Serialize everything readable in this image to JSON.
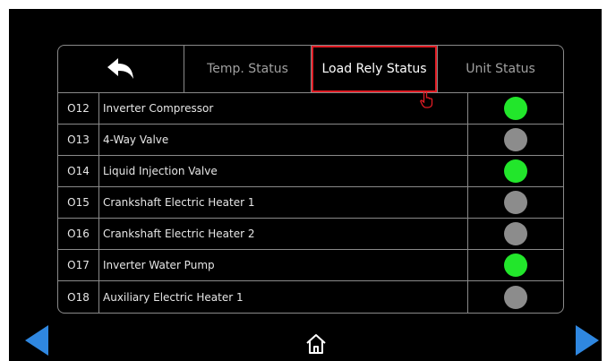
{
  "tabs": {
    "back_icon": "back-arrow-icon",
    "temp_label": "Temp. Status",
    "load_label": "Load Rely Status",
    "unit_label": "Unit Status"
  },
  "colors": {
    "on": "#22e62b",
    "off": "#8c8c8c",
    "highlight": "#e01c24",
    "nav": "#2f87e0"
  },
  "rows": [
    {
      "code": "O12",
      "name": "Inverter Compressor",
      "status": "on"
    },
    {
      "code": "O13",
      "name": "4-Way Valve",
      "status": "off"
    },
    {
      "code": "O14",
      "name": "Liquid Injection Valve",
      "status": "on"
    },
    {
      "code": "O15",
      "name": "Crankshaft Electric Heater 1",
      "status": "off"
    },
    {
      "code": "O16",
      "name": "Crankshaft Electric Heater 2",
      "status": "off"
    },
    {
      "code": "O17",
      "name": "Inverter Water Pump",
      "status": "on"
    },
    {
      "code": "O18",
      "name": "Auxiliary Electric Heater 1",
      "status": "off"
    }
  ],
  "footer": {
    "prev_icon": "prev-page-arrow-icon",
    "home_icon": "home-icon",
    "next_icon": "next-page-arrow-icon"
  }
}
